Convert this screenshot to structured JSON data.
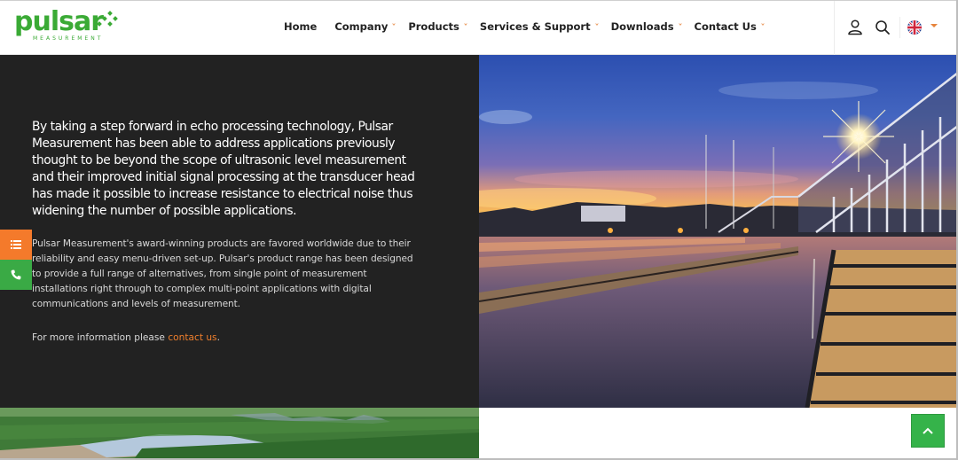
{
  "brand": {
    "name": "pulsar",
    "tagline": "MEASUREMENT",
    "color": "#3aaa35"
  },
  "nav": {
    "items": [
      {
        "label": "Home",
        "has_dropdown": false
      },
      {
        "label": "Company",
        "has_dropdown": true
      },
      {
        "label": "Products",
        "has_dropdown": true
      },
      {
        "label": "Services & Support",
        "has_dropdown": true
      },
      {
        "label": "Downloads",
        "has_dropdown": true
      },
      {
        "label": "Contact Us",
        "has_dropdown": true
      }
    ],
    "chevron_glyph": "˅",
    "accent": "#e6843c"
  },
  "header_tools": {
    "user_icon": "user-icon",
    "search_icon": "search-icon",
    "language": "English (UK)",
    "language_icon": "uk-flag-icon"
  },
  "content": {
    "lead": "By taking a step forward in echo processing technology, Pulsar Measurement has been able to address applications previously thought to be beyond the scope of ultrasonic level measurement and their improved initial signal processing at the transducer head has made it possible to increase resistance to electrical noise thus widening the number of possible applications.",
    "body": "Pulsar Measurement's award-winning products are favored worldwide due to their reliability and easy menu-driven set-up. Pulsar's product range has been designed to provide a full range of alternatives, from single point of measurement installations right through to complex multi-point applications with digital communications and levels of measurement.",
    "more_prefix": "For more information please ",
    "more_link": "contact us",
    "more_suffix": ".",
    "link_color": "#f07f2d"
  },
  "side_buttons": [
    {
      "icon": "list-icon",
      "color": "#f47a2b"
    },
    {
      "icon": "phone-icon",
      "color": "#3aaa45"
    }
  ],
  "images": {
    "hero": "water-treatment-plant-sunset",
    "footer_left": "forest-lake-aerial"
  },
  "back_to_top": {
    "icon": "chevron-up-icon",
    "color": "#35b34a"
  }
}
